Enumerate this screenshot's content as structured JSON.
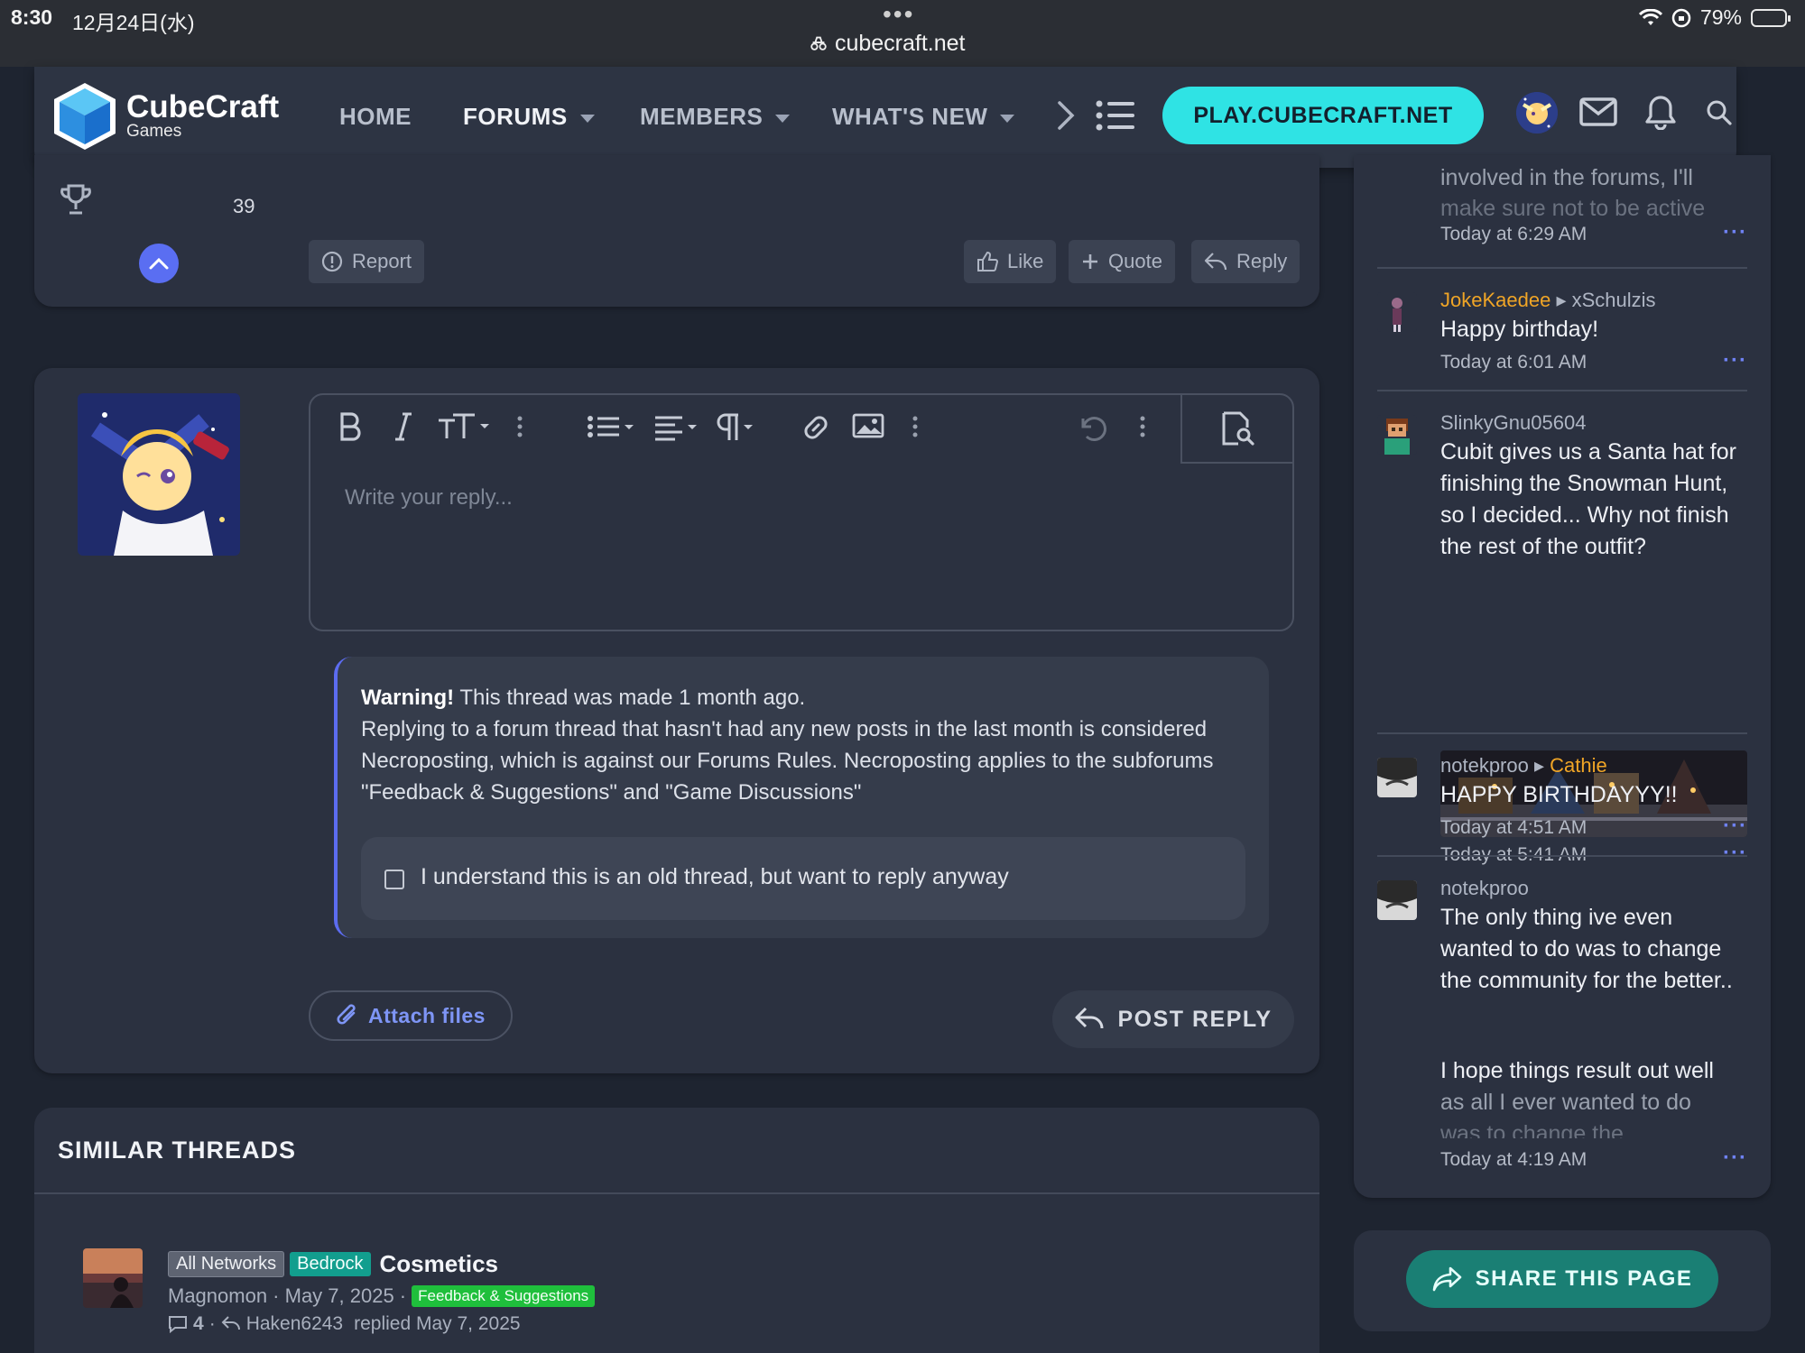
{
  "status_bar": {
    "time": "8:30",
    "date": "12月24日(水)",
    "url": "cubecraft.net",
    "battery": "79%"
  },
  "nav": {
    "brand": "CubeCraft",
    "brand_sub": "Games",
    "items": [
      {
        "label": "HOME"
      },
      {
        "label": "FORUMS"
      },
      {
        "label": "MEMBERS"
      },
      {
        "label": "WHAT'S NEW"
      }
    ],
    "play_label": "PLAY.CUBECRAFT.NET"
  },
  "post": {
    "trophy_count": "39",
    "report_label": "Report",
    "like_label": "Like",
    "quote_label": "Quote",
    "reply_label": "Reply"
  },
  "editor": {
    "placeholder": "Write your reply..."
  },
  "warning": {
    "title": "Warning!",
    "line1": " This thread was made 1 month ago.",
    "body": "Replying to a forum thread that hasn't had any new posts in the last month is considered Necroposting, which is against our Forums Rules. Necroposting applies to the subforums \"Feedback & Suggestions\" and \"Game Discussions\"",
    "checkbox_label": "I understand this is an old thread, but want to reply anyway"
  },
  "actions": {
    "attach_label": "Attach files",
    "post_reply_label": "POST REPLY"
  },
  "similar": {
    "title": "SIMILAR THREADS",
    "thread": {
      "tag1": "All Networks",
      "tag2": "Bedrock",
      "title": "Cosmetics",
      "author_date": "Magnomon · May 7, 2025 ·",
      "forum_tag": "Feedback & Suggestions",
      "replies": "4",
      "replied_by": "Haken6243",
      "replied_text": "replied May 7, 2025"
    }
  },
  "sidebar": {
    "items": [
      {
        "body_line1": "involved in the forums, I'll",
        "body_line2": "make sure not to be active",
        "time": "Today at 6:29 AM"
      },
      {
        "user": "JokeKaedee",
        "arrow": "▸",
        "target": "xSchulzis",
        "body": "Happy birthday!",
        "time": "Today at 6:01 AM"
      },
      {
        "user": "SlinkyGnu05604",
        "body": "Cubit gives us a Santa hat for finishing the Snowman Hunt, so I decided... Why not finish the rest of the outfit?",
        "time": "Today at 5:41 AM"
      },
      {
        "user": "notekproo",
        "arrow": "▸",
        "target": "Cathie",
        "body": "HAPPY BIRTHDAYYY!!",
        "time": "Today at 4:51 AM"
      },
      {
        "user": "notekproo",
        "body": "The only thing ive even wanted to do was to change the community for the better..",
        "body2a": "I hope things result out well",
        "body2b": "as all I ever wanted to do",
        "body2c": "was to change the",
        "time": "Today at 4:19 AM"
      }
    ],
    "more": "···",
    "share_label": "SHARE THIS PAGE"
  },
  "colors": {
    "accent": "#5a6ef2",
    "play": "#2fe3e4",
    "share": "#1a7f74",
    "gold_user": "#f0a526"
  }
}
